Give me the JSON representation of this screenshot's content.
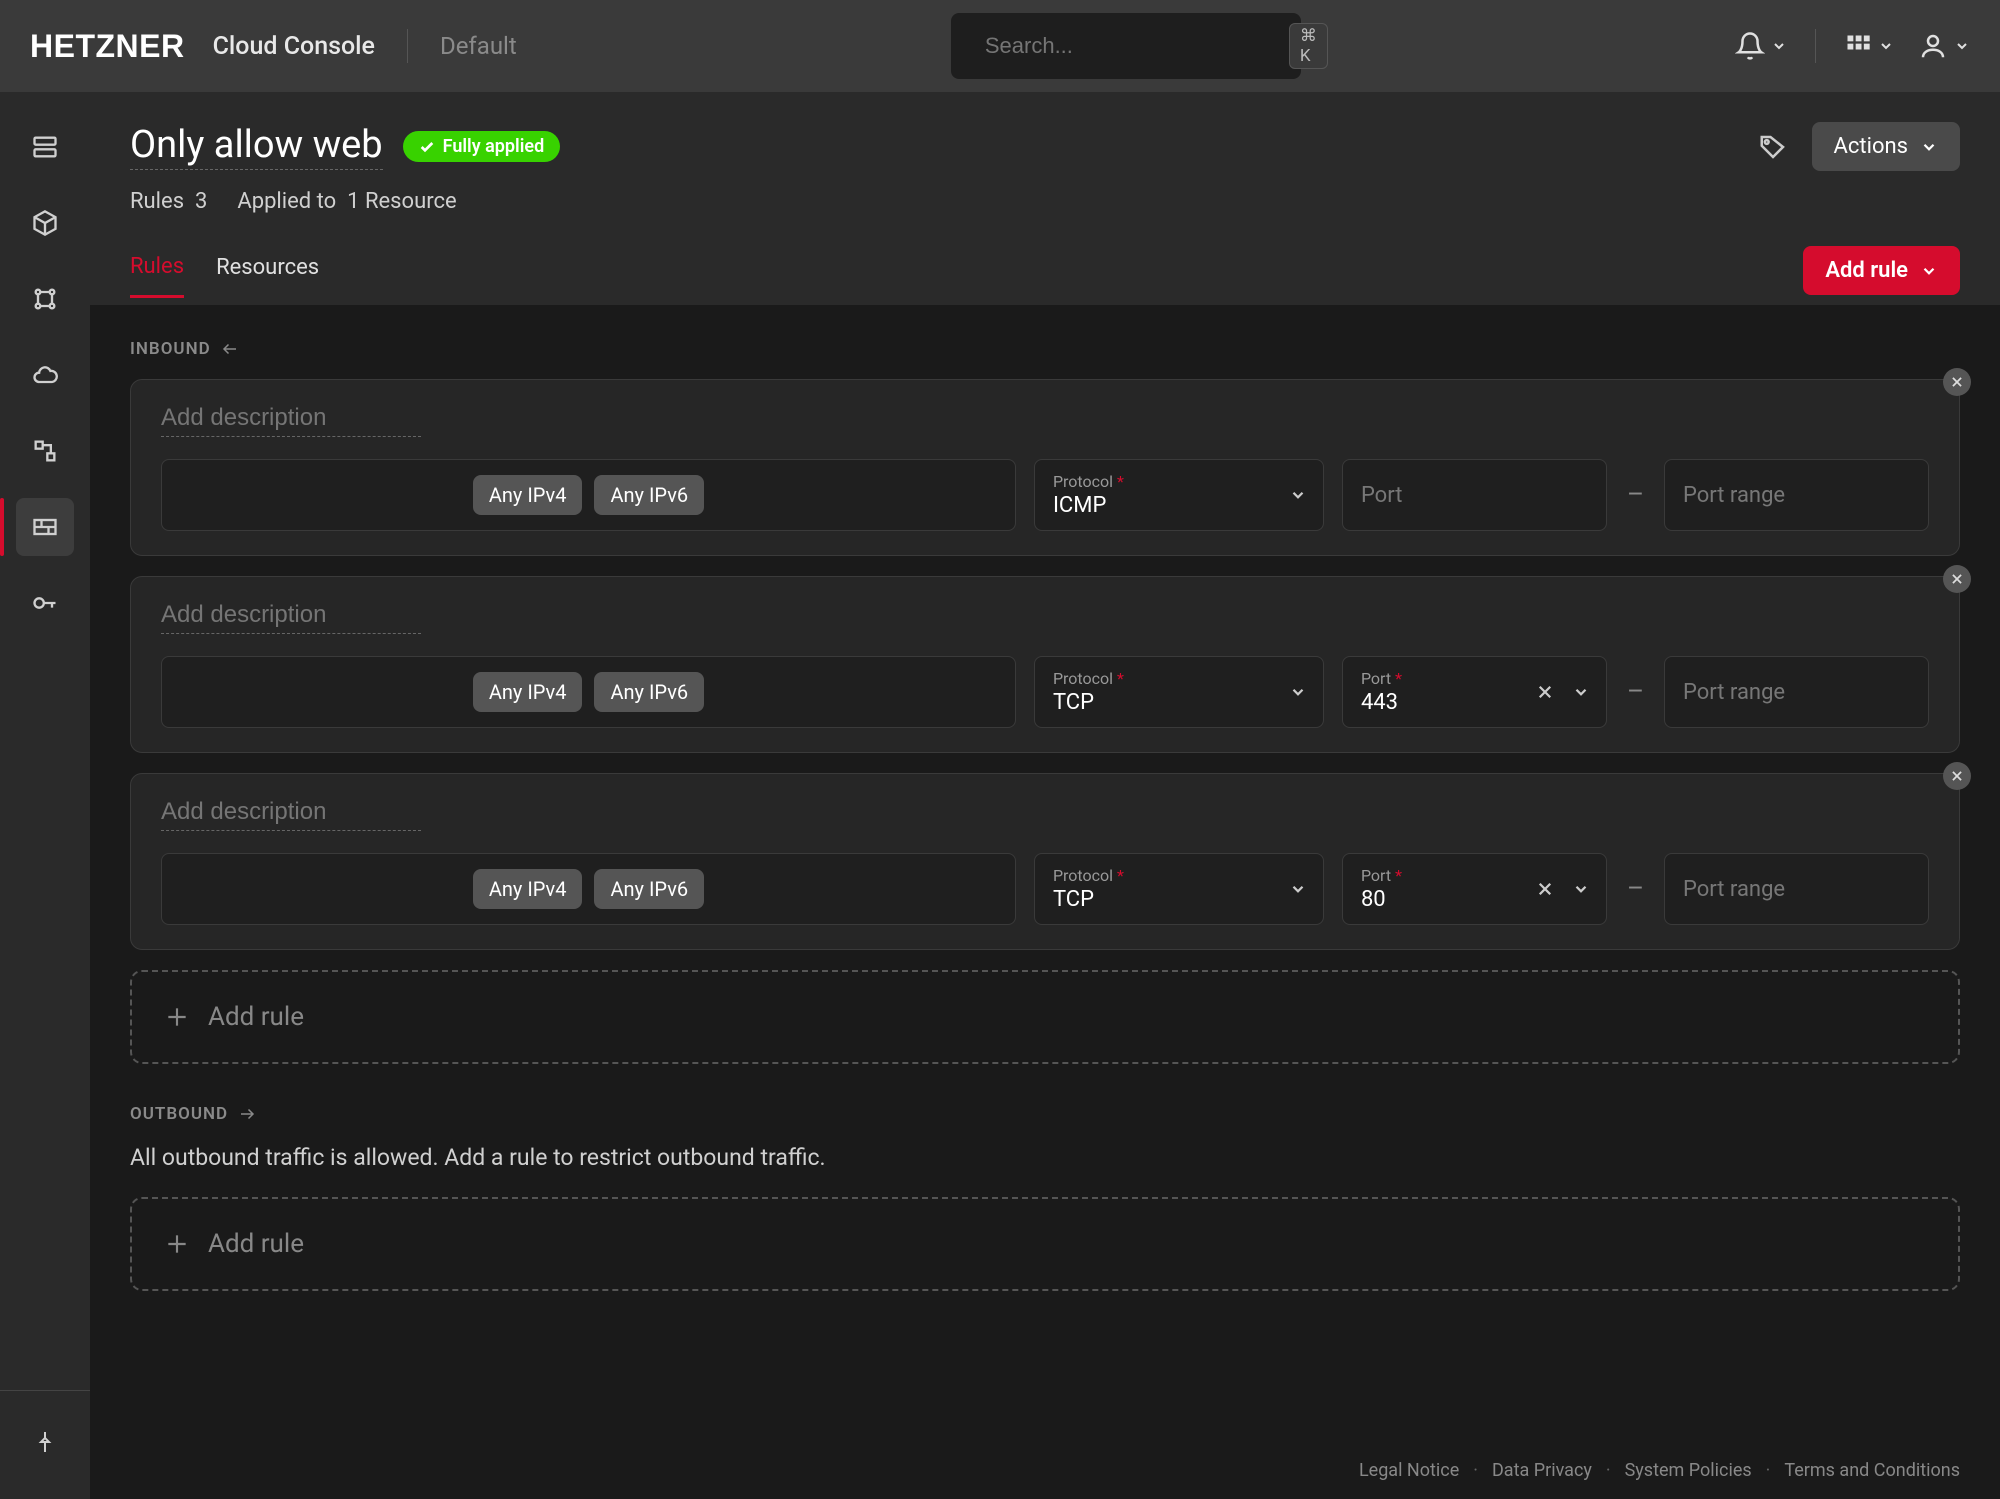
{
  "topbar": {
    "logo": "HETZNER",
    "console": "Cloud Console",
    "project": "Default",
    "search_placeholder": "Search...",
    "shortcut": "⌘ K"
  },
  "header": {
    "title": "Only allow web",
    "badge": "Fully applied",
    "rules_label": "Rules",
    "rules_count": "3",
    "applied_label": "Applied to",
    "applied_count": "1",
    "applied_unit": "Resource",
    "actions": "Actions"
  },
  "tabs": {
    "rules": "Rules",
    "resources": "Resources",
    "add_rule": "Add rule"
  },
  "sections": {
    "inbound": "INBOUND",
    "outbound": "OUTBOUND",
    "outbound_note": "All outbound traffic is allowed. Add a rule to restrict outbound traffic.",
    "add_rule_row": "Add rule"
  },
  "labels": {
    "description_placeholder": "Add description",
    "protocol": "Protocol",
    "port": "Port",
    "port_placeholder": "Port",
    "portrange_placeholder": "Port range",
    "chip_ipv4": "Any IPv4",
    "chip_ipv6": "Any IPv6"
  },
  "rules": [
    {
      "protocol": "ICMP",
      "port": ""
    },
    {
      "protocol": "TCP",
      "port": "443"
    },
    {
      "protocol": "TCP",
      "port": "80"
    }
  ],
  "footer": {
    "legal": "Legal Notice",
    "privacy": "Data Privacy",
    "policies": "System Policies",
    "terms": "Terms and Conditions"
  }
}
